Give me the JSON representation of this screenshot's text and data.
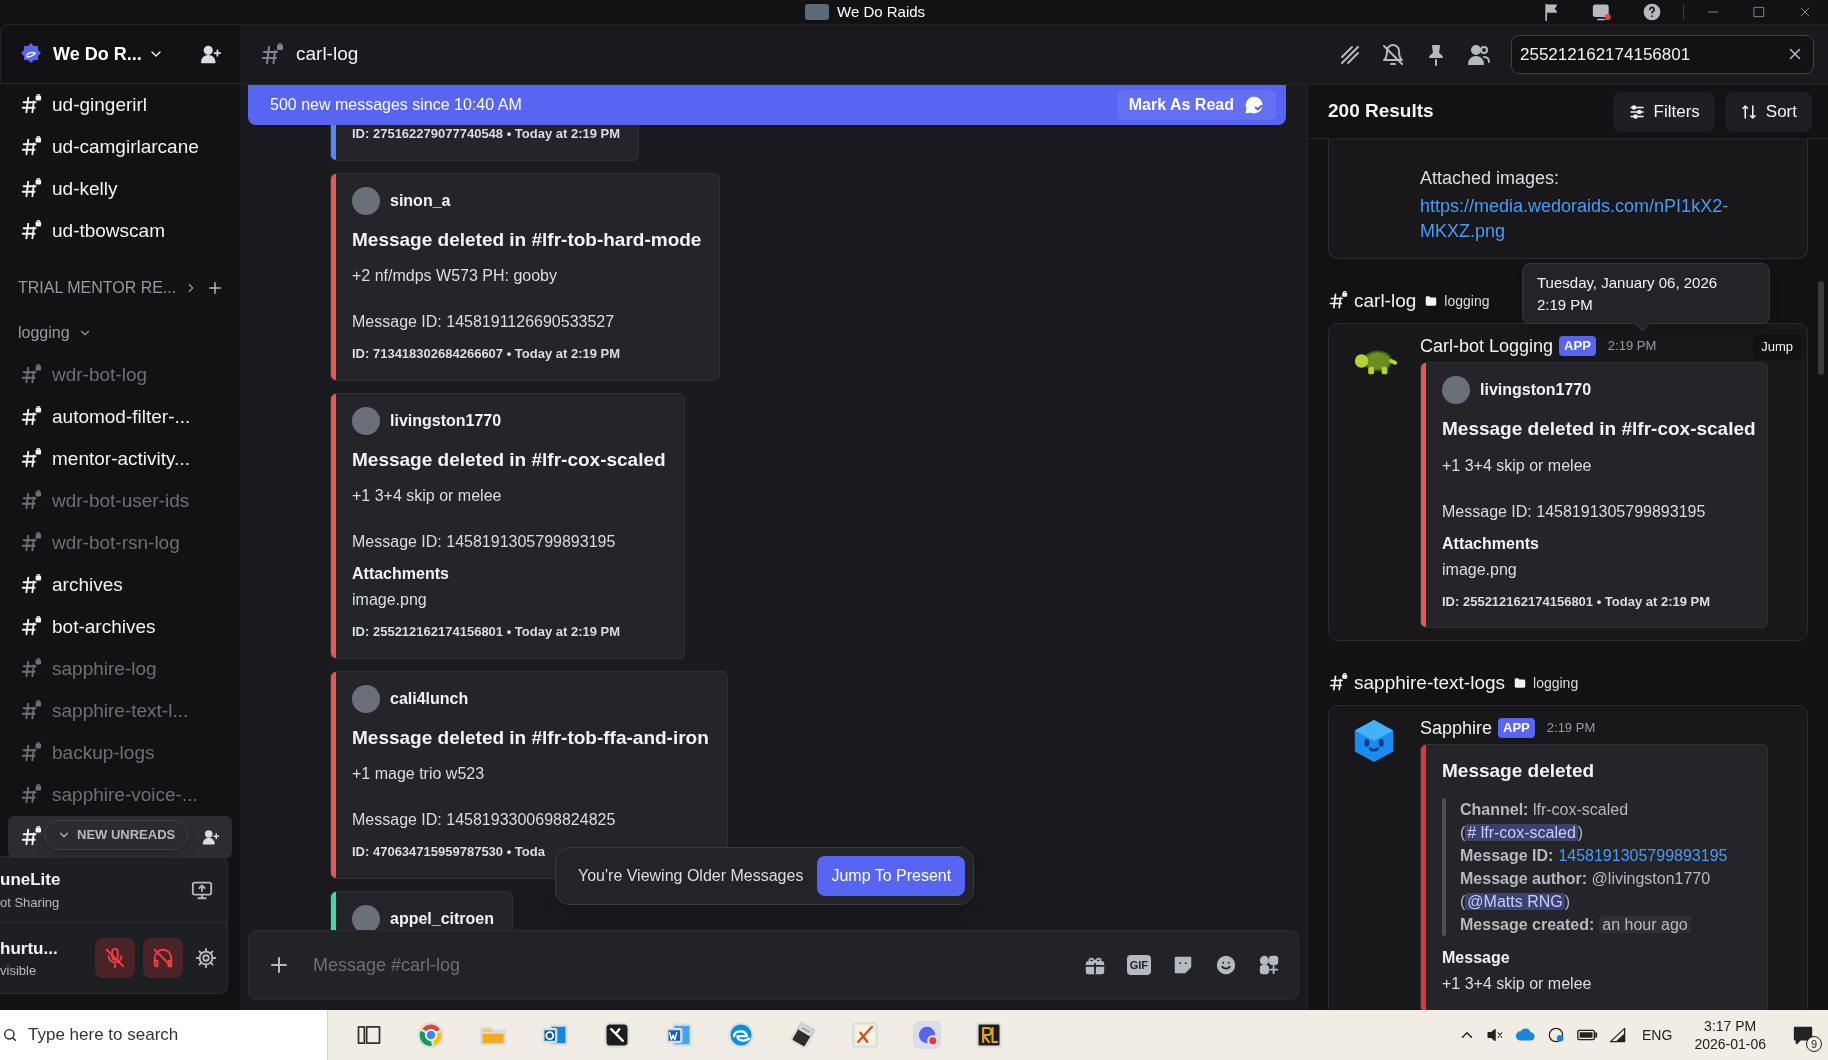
{
  "titlebar": {
    "title": "We Do Raids"
  },
  "server": {
    "name": "We Do R..."
  },
  "sidebar": {
    "items": [
      {
        "kind": "channel",
        "name": "ud-gingerirl",
        "unread": true
      },
      {
        "kind": "channel",
        "name": "ud-camgirlarcane",
        "unread": true
      },
      {
        "kind": "channel",
        "name": "ud-kelly",
        "unread": true
      },
      {
        "kind": "channel",
        "name": "ud-tbowscam",
        "unread": true
      },
      {
        "kind": "category",
        "name": "TRIAL MENTOR RE...",
        "expanded": false
      },
      {
        "kind": "category",
        "name": "logging",
        "expanded": true
      },
      {
        "kind": "channel",
        "name": "wdr-bot-log",
        "unread": false
      },
      {
        "kind": "channel",
        "name": "automod-filter-...",
        "unread": true
      },
      {
        "kind": "channel",
        "name": "mentor-activity...",
        "unread": true
      },
      {
        "kind": "channel",
        "name": "wdr-bot-user-ids",
        "unread": false
      },
      {
        "kind": "channel",
        "name": "wdr-bot-rsn-log",
        "unread": false
      },
      {
        "kind": "channel",
        "name": "archives",
        "unread": true
      },
      {
        "kind": "channel",
        "name": "bot-archives",
        "unread": true
      },
      {
        "kind": "channel",
        "name": "sapphire-log",
        "unread": false
      },
      {
        "kind": "channel",
        "name": "sapphire-text-l...",
        "unread": false
      },
      {
        "kind": "channel",
        "name": "backup-logs",
        "unread": false
      },
      {
        "kind": "channel",
        "name": "sapphire-voice-...",
        "unread": false
      }
    ]
  },
  "new_unreads": "NEW UNREADS",
  "voice_panel": {
    "app": "uneLite",
    "status": "ot Sharing"
  },
  "user_panel": {
    "name": "hurtu...",
    "status": "visible",
    "mic_muted": true,
    "deafened": true
  },
  "channel": {
    "name": "carl-log"
  },
  "banner": {
    "text": "500 new messages since 10:40 AM",
    "action": "Mark As Read"
  },
  "messages": [
    {
      "color": "#4f8cf7",
      "footer": "ID: 275162279077740548 • Today at 2:19 PM"
    },
    {
      "color": "#e5594b",
      "author": "sinon_a",
      "title": "Message deleted in #lfr-tob-hard-mode",
      "body": "+2 nf/mdps W573 PH: gooby",
      "message_id": "Message ID: 1458191126690533527",
      "footer": "ID: 713418302684266607 • Today at 2:19 PM"
    },
    {
      "color": "#e5594b",
      "author": "livingston1770",
      "title": "Message deleted in #lfr-cox-scaled",
      "body": "+1 3+4 skip or melee",
      "message_id": "Message ID: 1458191305799893195",
      "attachments_label": "Attachments",
      "attachment": "image.png",
      "footer": "ID: 255212162174156801 • Today at 2:19 PM"
    },
    {
      "color": "#e5594b",
      "author": "cali4lunch",
      "title": "Message deleted in #lfr-tob-ffa-and-iron",
      "body": "+1 mage trio w523",
      "message_id": "Message ID: 1458193300698824825",
      "footer": "ID: 470634715959787530 • Toda"
    },
    {
      "color": "#43d9a0",
      "author": "appel_citroen"
    }
  ],
  "older_toast": {
    "text": "You're Viewing Older Messages",
    "action": "Jump To Present"
  },
  "composer": {
    "placeholder": "Message #carl-log",
    "gif": "GIF"
  },
  "search": {
    "value": "255212162174156801",
    "results_count": "200 Results",
    "filters": "Filters",
    "sort": "Sort",
    "results": [
      {
        "kind": "partial",
        "label": "Attached images:",
        "link": "https://media.wedoraids.com/nPI1kX2-MKXZ.png"
      },
      {
        "kind": "message",
        "channel": "carl-log",
        "category": "logging",
        "author": "Carl-bot Logging",
        "avatar": {
          "kind": "turtle"
        },
        "badge": "APP",
        "time": "2:19 PM",
        "jump": "Jump",
        "embed": {
          "color": "#e5594b",
          "author": "livingston1770",
          "title": "Message deleted in #lfr-cox-scaled",
          "body": "+1 3+4 skip or melee",
          "message_id": "Message ID: 1458191305799893195",
          "attachments_label": "Attachments",
          "attachment": "image.png",
          "footer": "ID: 255212162174156801 • Today at 2:19 PM"
        }
      },
      {
        "kind": "message",
        "channel": "sapphire-text-logs",
        "category": "logging",
        "author": "Sapphire",
        "avatar": {
          "kind": "gem"
        },
        "badge": "APP",
        "time": "2:19 PM",
        "embed": {
          "color": "#d9393b",
          "title": "Message deleted",
          "fields": [
            {
              "parts": [
                {
                  "kind": "label",
                  "text": "Channel:"
                },
                {
                  "kind": "text",
                  "text": " lfr-cox-scaled ("
                },
                {
                  "kind": "mention",
                  "text": "# lfr-cox-scaled"
                },
                {
                  "kind": "text",
                  "text": ")"
                }
              ]
            },
            {
              "parts": [
                {
                  "kind": "label",
                  "text": "Message ID:"
                },
                {
                  "kind": "link",
                  "text": "1458191305799893195"
                }
              ]
            },
            {
              "parts": [
                {
                  "kind": "label",
                  "text": "Message author:"
                },
                {
                  "kind": "text",
                  "text": " @livingston1770 ("
                },
                {
                  "kind": "mention",
                  "text": "@Matts RNG"
                },
                {
                  "kind": "text",
                  "text": ")"
                }
              ]
            },
            {
              "parts": [
                {
                  "kind": "label",
                  "text": "Message created:"
                },
                {
                  "kind": "timestamp",
                  "text": "an hour ago"
                }
              ]
            }
          ],
          "section_label": "Message",
          "section_text": "+1 3+4 skip or melee"
        }
      }
    ],
    "tooltip": {
      "date": "Tuesday, January 06, 2026",
      "time": "2:19 PM"
    }
  },
  "taskbar": {
    "search_placeholder": "Type here to search",
    "language": "ENG",
    "time": "3:17 PM",
    "date": "2026-01-06",
    "notifications": "9"
  }
}
